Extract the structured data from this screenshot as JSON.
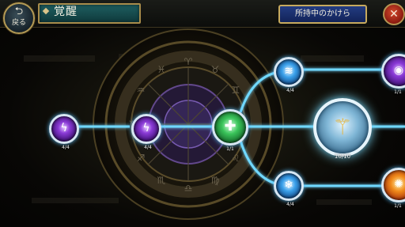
{
  "header": {
    "back_label": "戻る",
    "title": "覚醒",
    "fragments_button": "所持中のかけら"
  },
  "icons": {
    "back": "back-arrow-icon",
    "close": "close-icon"
  },
  "colors": {
    "path_glow": "#6fd8ff",
    "frame_gold": "#b39a55",
    "title_panel": "#1e5e60",
    "fragments_button": "#233c82",
    "close_button": "#c03a22"
  },
  "nodes": [
    {
      "id": "lightning-1",
      "element": "lightning",
      "level": "4/4"
    },
    {
      "id": "lightning-2",
      "element": "lightning",
      "level": "4/4"
    },
    {
      "id": "heal",
      "element": "heal",
      "level": "1/1"
    },
    {
      "id": "water-top",
      "element": "water",
      "level": "4/4"
    },
    {
      "id": "ice-bottom",
      "element": "ice",
      "level": "4/4"
    },
    {
      "id": "staff-center",
      "element": "staff",
      "level": "10/10"
    },
    {
      "id": "dark-right",
      "element": "dark",
      "level": "1/1"
    },
    {
      "id": "fire-right",
      "element": "fire",
      "level": "1/1"
    }
  ]
}
